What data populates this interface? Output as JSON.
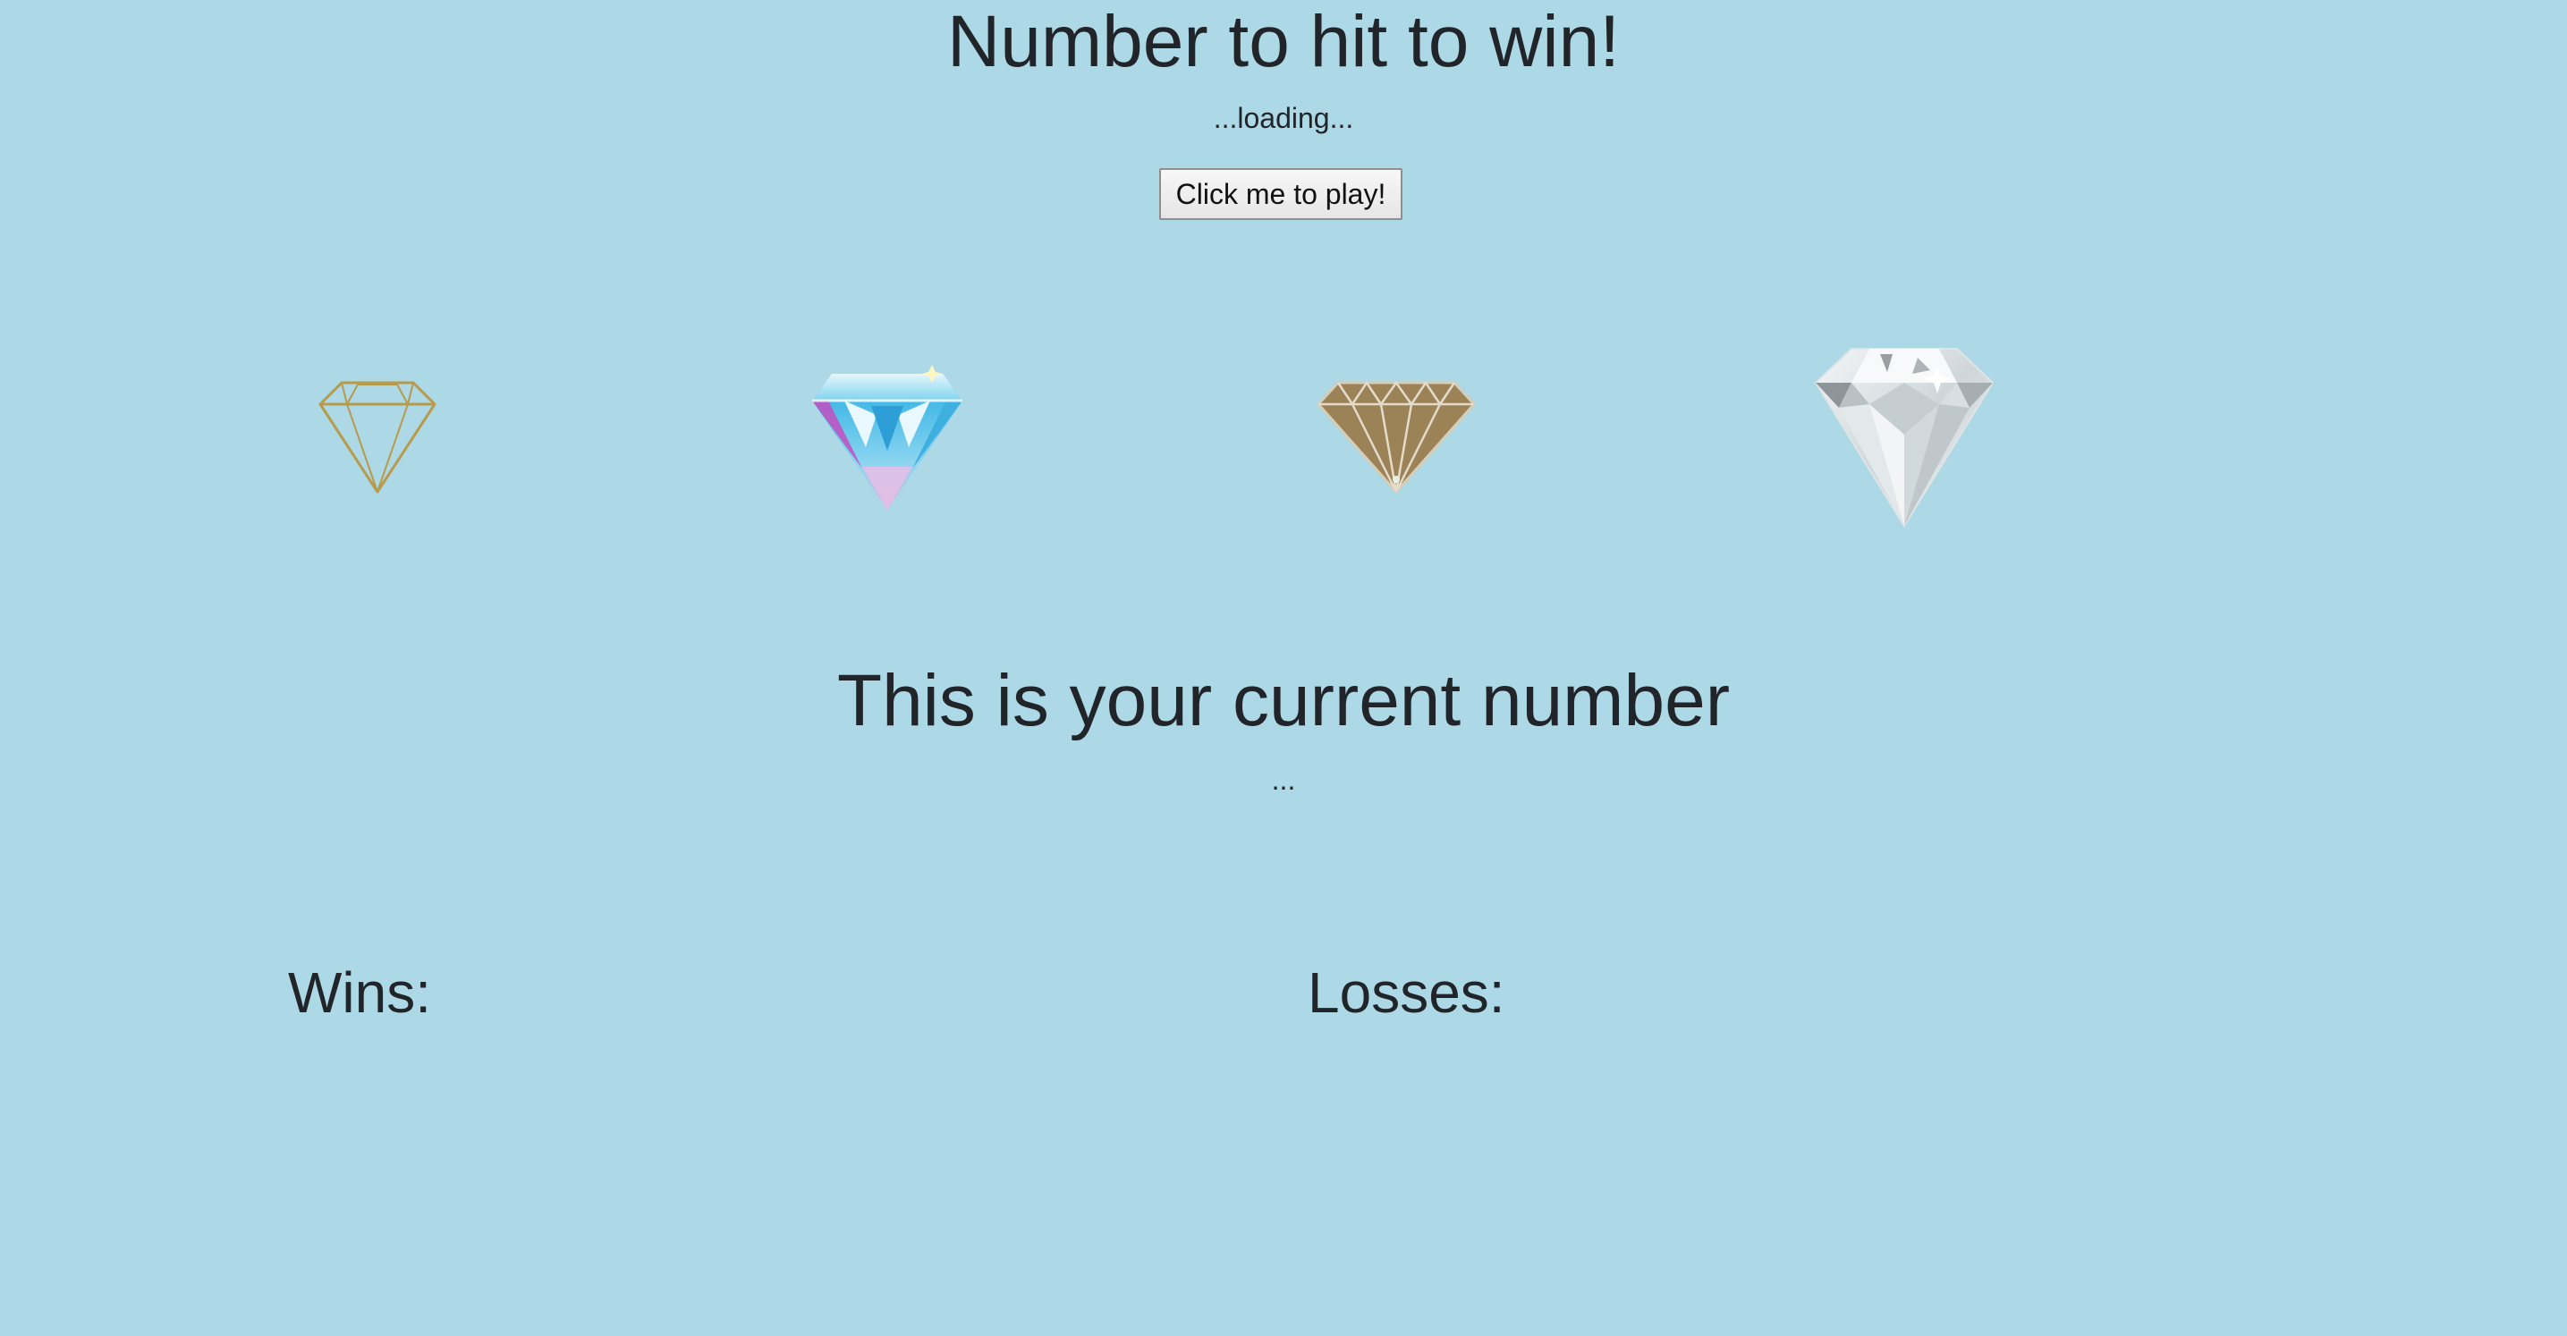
{
  "header": {
    "title": "Number to hit to win!",
    "target_number": "...loading..."
  },
  "play_button": {
    "label": "Click me to play!"
  },
  "crystals": [
    {
      "icon": "gold-outline-diamond-icon",
      "color": "#b79b4d"
    },
    {
      "icon": "blue-crystal-diamond-icon",
      "color": "#4fc3e8"
    },
    {
      "icon": "bronze-diamond-icon",
      "color": "#9c8257"
    },
    {
      "icon": "white-diamond-icon",
      "color": "#e8ecee"
    }
  ],
  "current": {
    "title": "This is your current number",
    "value": "..."
  },
  "scores": {
    "wins_label": "Wins:",
    "losses_label": "Losses:"
  },
  "colors": {
    "background": "#add8e6",
    "text": "#212529"
  }
}
